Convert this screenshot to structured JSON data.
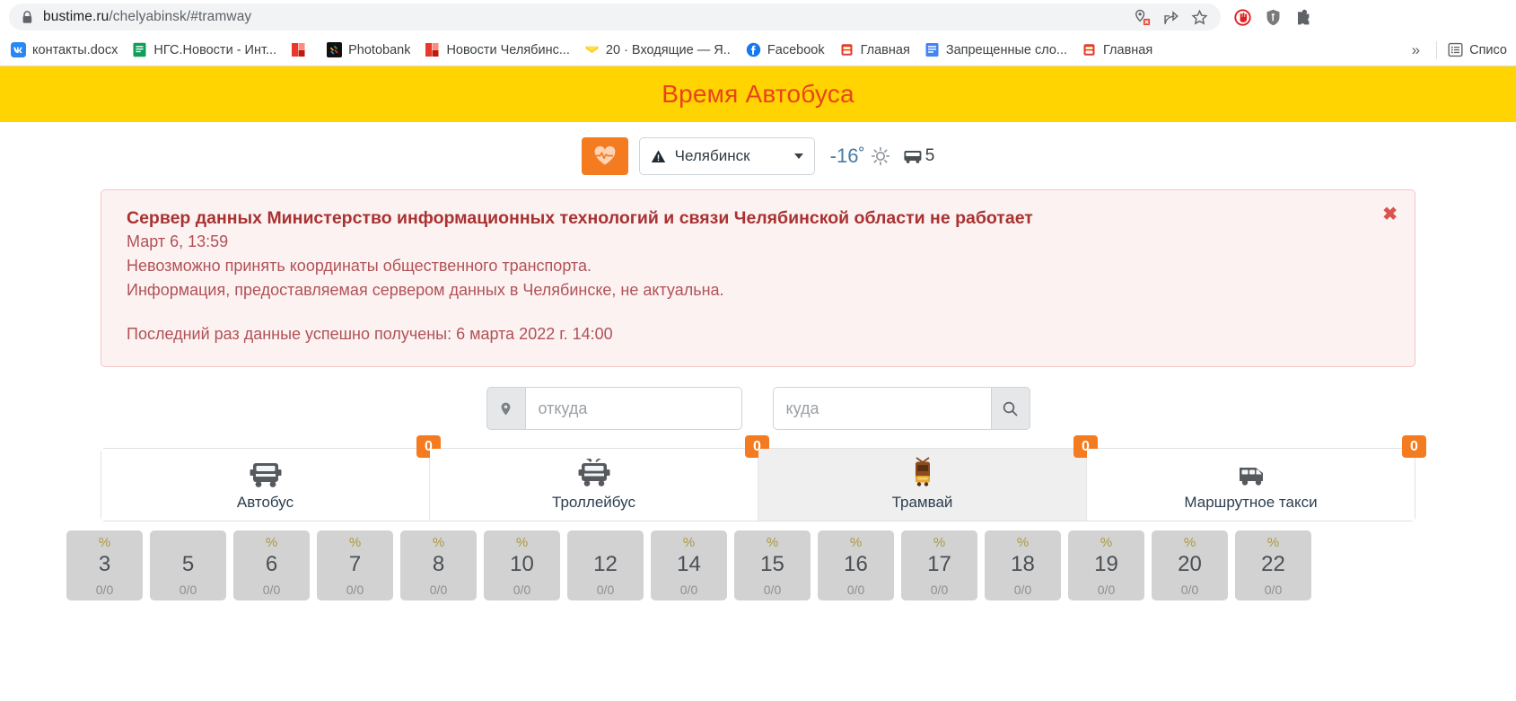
{
  "browser": {
    "url_host": "bustime.ru",
    "url_path": "/chelyabinsk/#tramway",
    "lock_icon": "lock-icon",
    "omnibox_icons": [
      {
        "name": "blocked-location-icon"
      },
      {
        "name": "share-icon"
      },
      {
        "name": "bookmark-star-icon"
      }
    ],
    "extension_icons": [
      {
        "name": "adblock-icon"
      },
      {
        "name": "shield-extension-icon"
      },
      {
        "name": "puzzle-extensions-icon"
      }
    ],
    "bookmarks": [
      {
        "label": "контакты.docx",
        "icon": "vk-icon"
      },
      {
        "label": "НГС.Новости - Инт...",
        "icon": "google-docs-icon"
      },
      {
        "label": "",
        "icon": "red-square-icon"
      },
      {
        "label": "Photobank",
        "icon": "joomla-icon"
      },
      {
        "label": "Новости Челябинс...",
        "icon": "red-square-icon"
      },
      {
        "label": "20 · Входящие — Я...",
        "icon": "yandex-mail-icon"
      },
      {
        "label": "Facebook",
        "icon": "facebook-icon"
      },
      {
        "label": "Главная",
        "icon": "red-app-icon"
      },
      {
        "label": "Запрещенные сло...",
        "icon": "blue-doc-icon"
      },
      {
        "label": "Главная",
        "icon": "red-app-icon"
      }
    ],
    "overflow_label": "»",
    "reading_list_label": "Списо",
    "reading_list_icon": "reading-list-icon"
  },
  "site": {
    "title": "Время Автобуса",
    "header_bg": "#ffd400",
    "title_color": "#e8441c"
  },
  "controls": {
    "pulse_button": {
      "name": "pulse-heart-button",
      "color": "#f47b20"
    },
    "city": {
      "value": "Челябинск",
      "warning_icon": "warning-triangle-icon",
      "caret_icon": "chevron-down-icon"
    },
    "weather": {
      "temperature": "-16˚",
      "icon": "sun-icon",
      "color": "#4a7ba6"
    },
    "vehicles": {
      "icon": "bus-icon",
      "count": "5"
    }
  },
  "alert": {
    "title": "Сервер данных Министерство информационных технологий и связи Челябинской области не работает",
    "timestamp": "Март 6, 13:59",
    "line1": "Невозможно принять координаты общественного транспорта.",
    "line2": "Информация, предоставляемая сервером данных в Челябинске, не актуальна.",
    "line3": "Последний раз данные успешно получены: 6 марта 2022 г. 14:00",
    "close_label": "✖",
    "bg": "#fdf2f2",
    "border": "#f3c6c6",
    "title_color": "#a83232",
    "text_color": "#b05257"
  },
  "search": {
    "from_placeholder": "откуда",
    "from_value": "",
    "to_placeholder": "куда",
    "to_value": "",
    "pin_icon": "map-pin-icon",
    "search_icon": "search-icon"
  },
  "transport_tabs": [
    {
      "label": "Автобус",
      "badge": "0",
      "icon": "bus-icon",
      "active": false
    },
    {
      "label": "Троллейбус",
      "badge": "0",
      "icon": "trolleybus-icon",
      "active": false
    },
    {
      "label": "Трамвай",
      "badge": "0",
      "icon": "tram-icon",
      "active": true
    },
    {
      "label": "Маршрутное такси",
      "badge": "0",
      "icon": "minibus-taxi-icon",
      "active": false
    }
  ],
  "hour_chips": [
    {
      "pct": "%",
      "hour": "3",
      "count": "0/0"
    },
    {
      "pct": "",
      "hour": "5",
      "count": "0/0"
    },
    {
      "pct": "%",
      "hour": "6",
      "count": "0/0"
    },
    {
      "pct": "%",
      "hour": "7",
      "count": "0/0"
    },
    {
      "pct": "%",
      "hour": "8",
      "count": "0/0"
    },
    {
      "pct": "%",
      "hour": "10",
      "count": "0/0"
    },
    {
      "pct": "",
      "hour": "12",
      "count": "0/0"
    },
    {
      "pct": "%",
      "hour": "14",
      "count": "0/0"
    },
    {
      "pct": "%",
      "hour": "15",
      "count": "0/0"
    },
    {
      "pct": "%",
      "hour": "16",
      "count": "0/0"
    },
    {
      "pct": "%",
      "hour": "17",
      "count": "0/0"
    },
    {
      "pct": "%",
      "hour": "18",
      "count": "0/0"
    },
    {
      "pct": "%",
      "hour": "19",
      "count": "0/0"
    },
    {
      "pct": "%",
      "hour": "20",
      "count": "0/0"
    },
    {
      "pct": "%",
      "hour": "22",
      "count": "0/0"
    }
  ]
}
